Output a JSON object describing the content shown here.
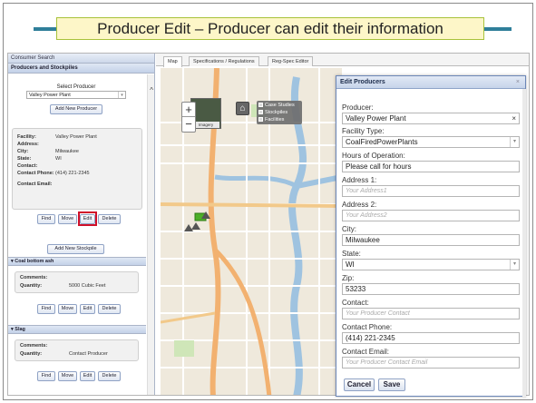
{
  "slide": {
    "title": "Producer Edit – Producer can edit their information"
  },
  "colors": {
    "accent": "#2f7f9a",
    "title_bg": "#fdf6c8",
    "highlight": "#d0102a"
  },
  "left_panel": {
    "header": "Consumer Search",
    "subheader": "Producers and Stockpiles",
    "select_label": "Select Producer",
    "selected_producer": "Valley Power Plant",
    "add_producer_label": "Add New Producer",
    "info": [
      {
        "label": "Facility:",
        "value": "Valley Power Plant"
      },
      {
        "label": "Address:",
        "value": ""
      },
      {
        "label": "City:",
        "value": "Milwaukee"
      },
      {
        "label": "State:",
        "value": "WI"
      },
      {
        "label": "Contact:",
        "value": ""
      },
      {
        "label": "Contact Phone:",
        "value": "(414) 221-2345"
      },
      {
        "label": "Contact Email:",
        "value": ""
      }
    ],
    "actions": {
      "find": "Find",
      "move": "Move",
      "edit": "Edit",
      "delete": "Delete"
    },
    "add_stockpile_label": "Add New Stockpile",
    "stockpiles": [
      {
        "name": "Coal bottom ash",
        "comments_label": "Comments:",
        "comments": "",
        "quantity_label": "Quantity:",
        "quantity": "5000 Cubic Feet"
      },
      {
        "name": "Slag",
        "comments_label": "Comments:",
        "comments": "",
        "quantity_label": "Quantity:",
        "quantity": "Contact Producer"
      }
    ]
  },
  "tabs": [
    "Map",
    "Specifications / Regulations",
    "Reg-Spec Editor"
  ],
  "map": {
    "imagery_label": "Imagery",
    "layers": [
      "Case Studies",
      "Stockpiles",
      "Facilities"
    ],
    "city_label": "Milwaukee"
  },
  "dialog": {
    "title": "Edit Producers",
    "close_icon": "×",
    "fields": {
      "producer_label": "Producer:",
      "producer_value": "Valley Power Plant",
      "facility_type_label": "Facility Type:",
      "facility_type_value": "CoalFiredPowerPlants",
      "hours_label": "Hours of Operation:",
      "hours_value": "Please call for hours",
      "address1_label": "Address 1:",
      "address1_placeholder": "Your Address1",
      "address2_label": "Address 2:",
      "address2_placeholder": "Your Address2",
      "city_label": "City:",
      "city_value": "Milwaukee",
      "state_label": "State:",
      "state_value": "WI",
      "zip_label": "Zip:",
      "zip_value": "53233",
      "contact_label": "Contact:",
      "contact_placeholder": "Your Producer Contact",
      "phone_label": "Contact Phone:",
      "phone_value": "(414) 221-2345",
      "email_label": "Contact Email:",
      "email_placeholder": "Your Producer Contact Email"
    },
    "cancel_label": "Cancel",
    "save_label": "Save"
  }
}
